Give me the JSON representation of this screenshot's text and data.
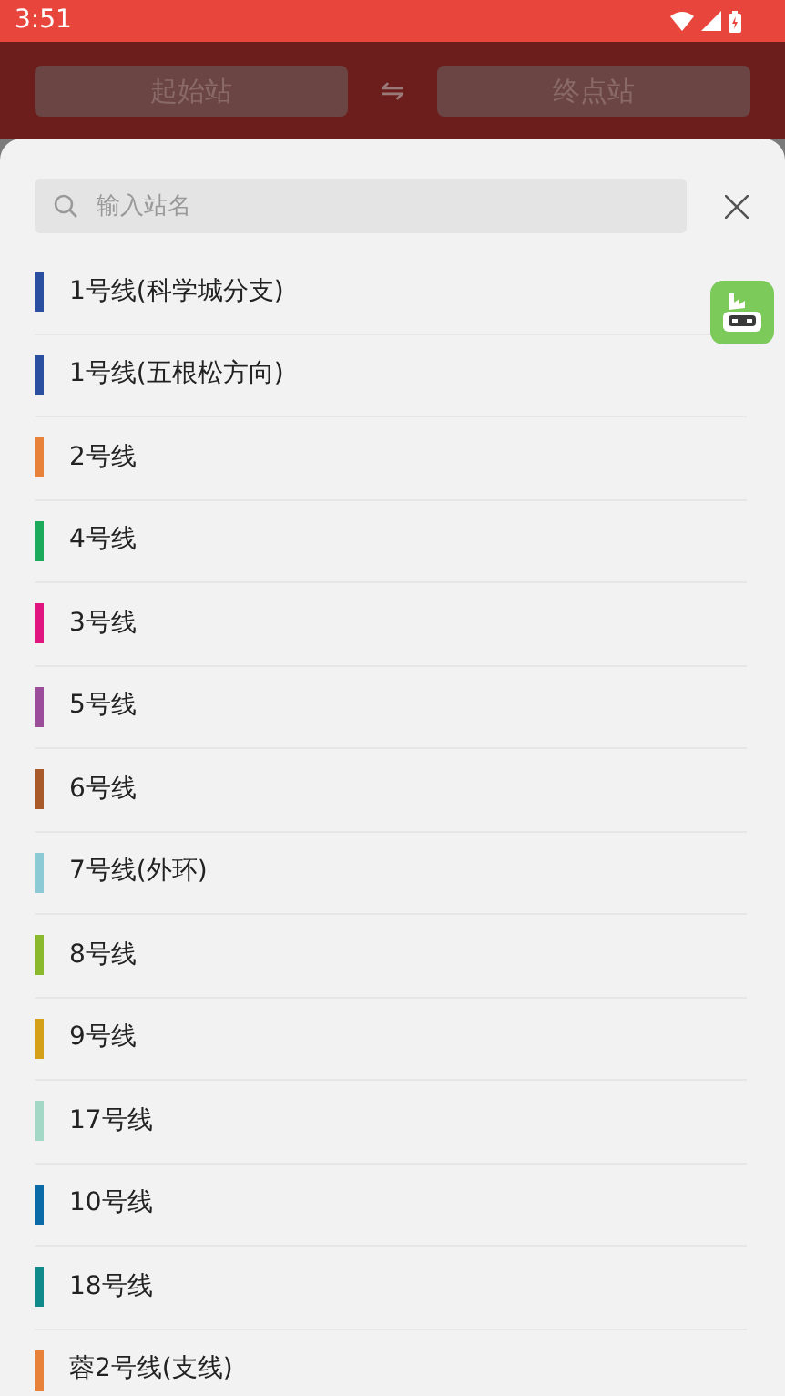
{
  "status_bar": {
    "time": "3:51"
  },
  "header": {
    "from": {
      "placeholder": "起始站"
    },
    "swap": "⇋",
    "to": {
      "placeholder": "终点站"
    }
  },
  "sheet": {
    "search": {
      "placeholder": "输入站名"
    },
    "lines": [
      {
        "name": "1号线(科学城分支)",
        "color": "#2b4fa0"
      },
      {
        "name": "1号线(五根松方向)",
        "color": "#2b4fa0"
      },
      {
        "name": "2号线",
        "color": "#e8813a"
      },
      {
        "name": "4号线",
        "color": "#1aaa5a"
      },
      {
        "name": "3号线",
        "color": "#e0157f"
      },
      {
        "name": "5号线",
        "color": "#9b4d9b"
      },
      {
        "name": "6号线",
        "color": "#a85a2a"
      },
      {
        "name": "7号线(外环)",
        "color": "#8ccbd6"
      },
      {
        "name": "8号线",
        "color": "#8ab92d"
      },
      {
        "name": "9号线",
        "color": "#d4a017"
      },
      {
        "name": "17号线",
        "color": "#a3d8c6"
      },
      {
        "name": "10号线",
        "color": "#0a6aa8"
      },
      {
        "name": "18号线",
        "color": "#108a8a"
      },
      {
        "name": "蓉2号线(支线)",
        "color": "#e8813a"
      }
    ]
  }
}
